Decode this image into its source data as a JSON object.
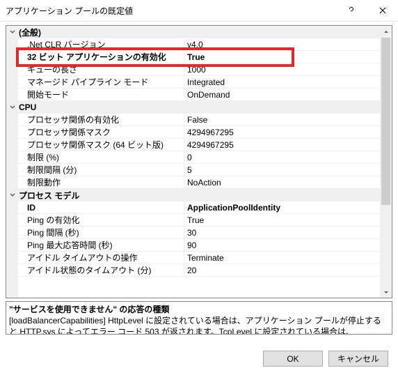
{
  "title": "アプリケーション プールの既定値",
  "highlight_row_index": 1,
  "categories": [
    {
      "label": "(全般)",
      "rows": [
        {
          "label": ".Net CLR バージョン",
          "value": "v4.0"
        },
        {
          "label": "32 ビット アプリケーションの有効化",
          "value": "True",
          "bold": true
        },
        {
          "label": "キューの長さ",
          "value": "1000"
        },
        {
          "label": "マネージド パイプライン モード",
          "value": "Integrated"
        },
        {
          "label": "開始モード",
          "value": "OnDemand"
        }
      ]
    },
    {
      "label": "CPU",
      "rows": [
        {
          "label": "プロセッサ関係の有効化",
          "value": "False"
        },
        {
          "label": "プロセッサ関係マスク",
          "value": "4294967295"
        },
        {
          "label": "プロセッサ関係マスク (64 ビット版)",
          "value": "4294967295"
        },
        {
          "label": "制限 (%)",
          "value": "0"
        },
        {
          "label": "制限間隔 (分)",
          "value": "5"
        },
        {
          "label": "制限動作",
          "value": "NoAction"
        }
      ]
    },
    {
      "label": "プロセス モデル",
      "rows": [
        {
          "label": "ID",
          "value": "ApplicationPoolIdentity",
          "bold": true
        },
        {
          "label": "Ping の有効化",
          "value": "True"
        },
        {
          "label": "Ping 間隔 (秒)",
          "value": "30"
        },
        {
          "label": "Ping 最大応答時間 (秒)",
          "value": "90"
        },
        {
          "label": "アイドル タイムアウトの操作",
          "value": "Terminate"
        },
        {
          "label": "アイドル状態のタイムアウト (分)",
          "value": "20"
        }
      ]
    }
  ],
  "description": {
    "title": "\"サービスを使用できません\" の応答の種類",
    "body": "[loadBalancerCapabilities] HttpLevel に設定されている場合は、アプリケーション プールが停止すると HTTP.sys によってエラー コード 503 が返されます。TcpLevel に設定されている場合は、HTTP.sys によって接続がリセットされます..."
  },
  "buttons": {
    "ok": "OK",
    "cancel": "キャンセル"
  }
}
